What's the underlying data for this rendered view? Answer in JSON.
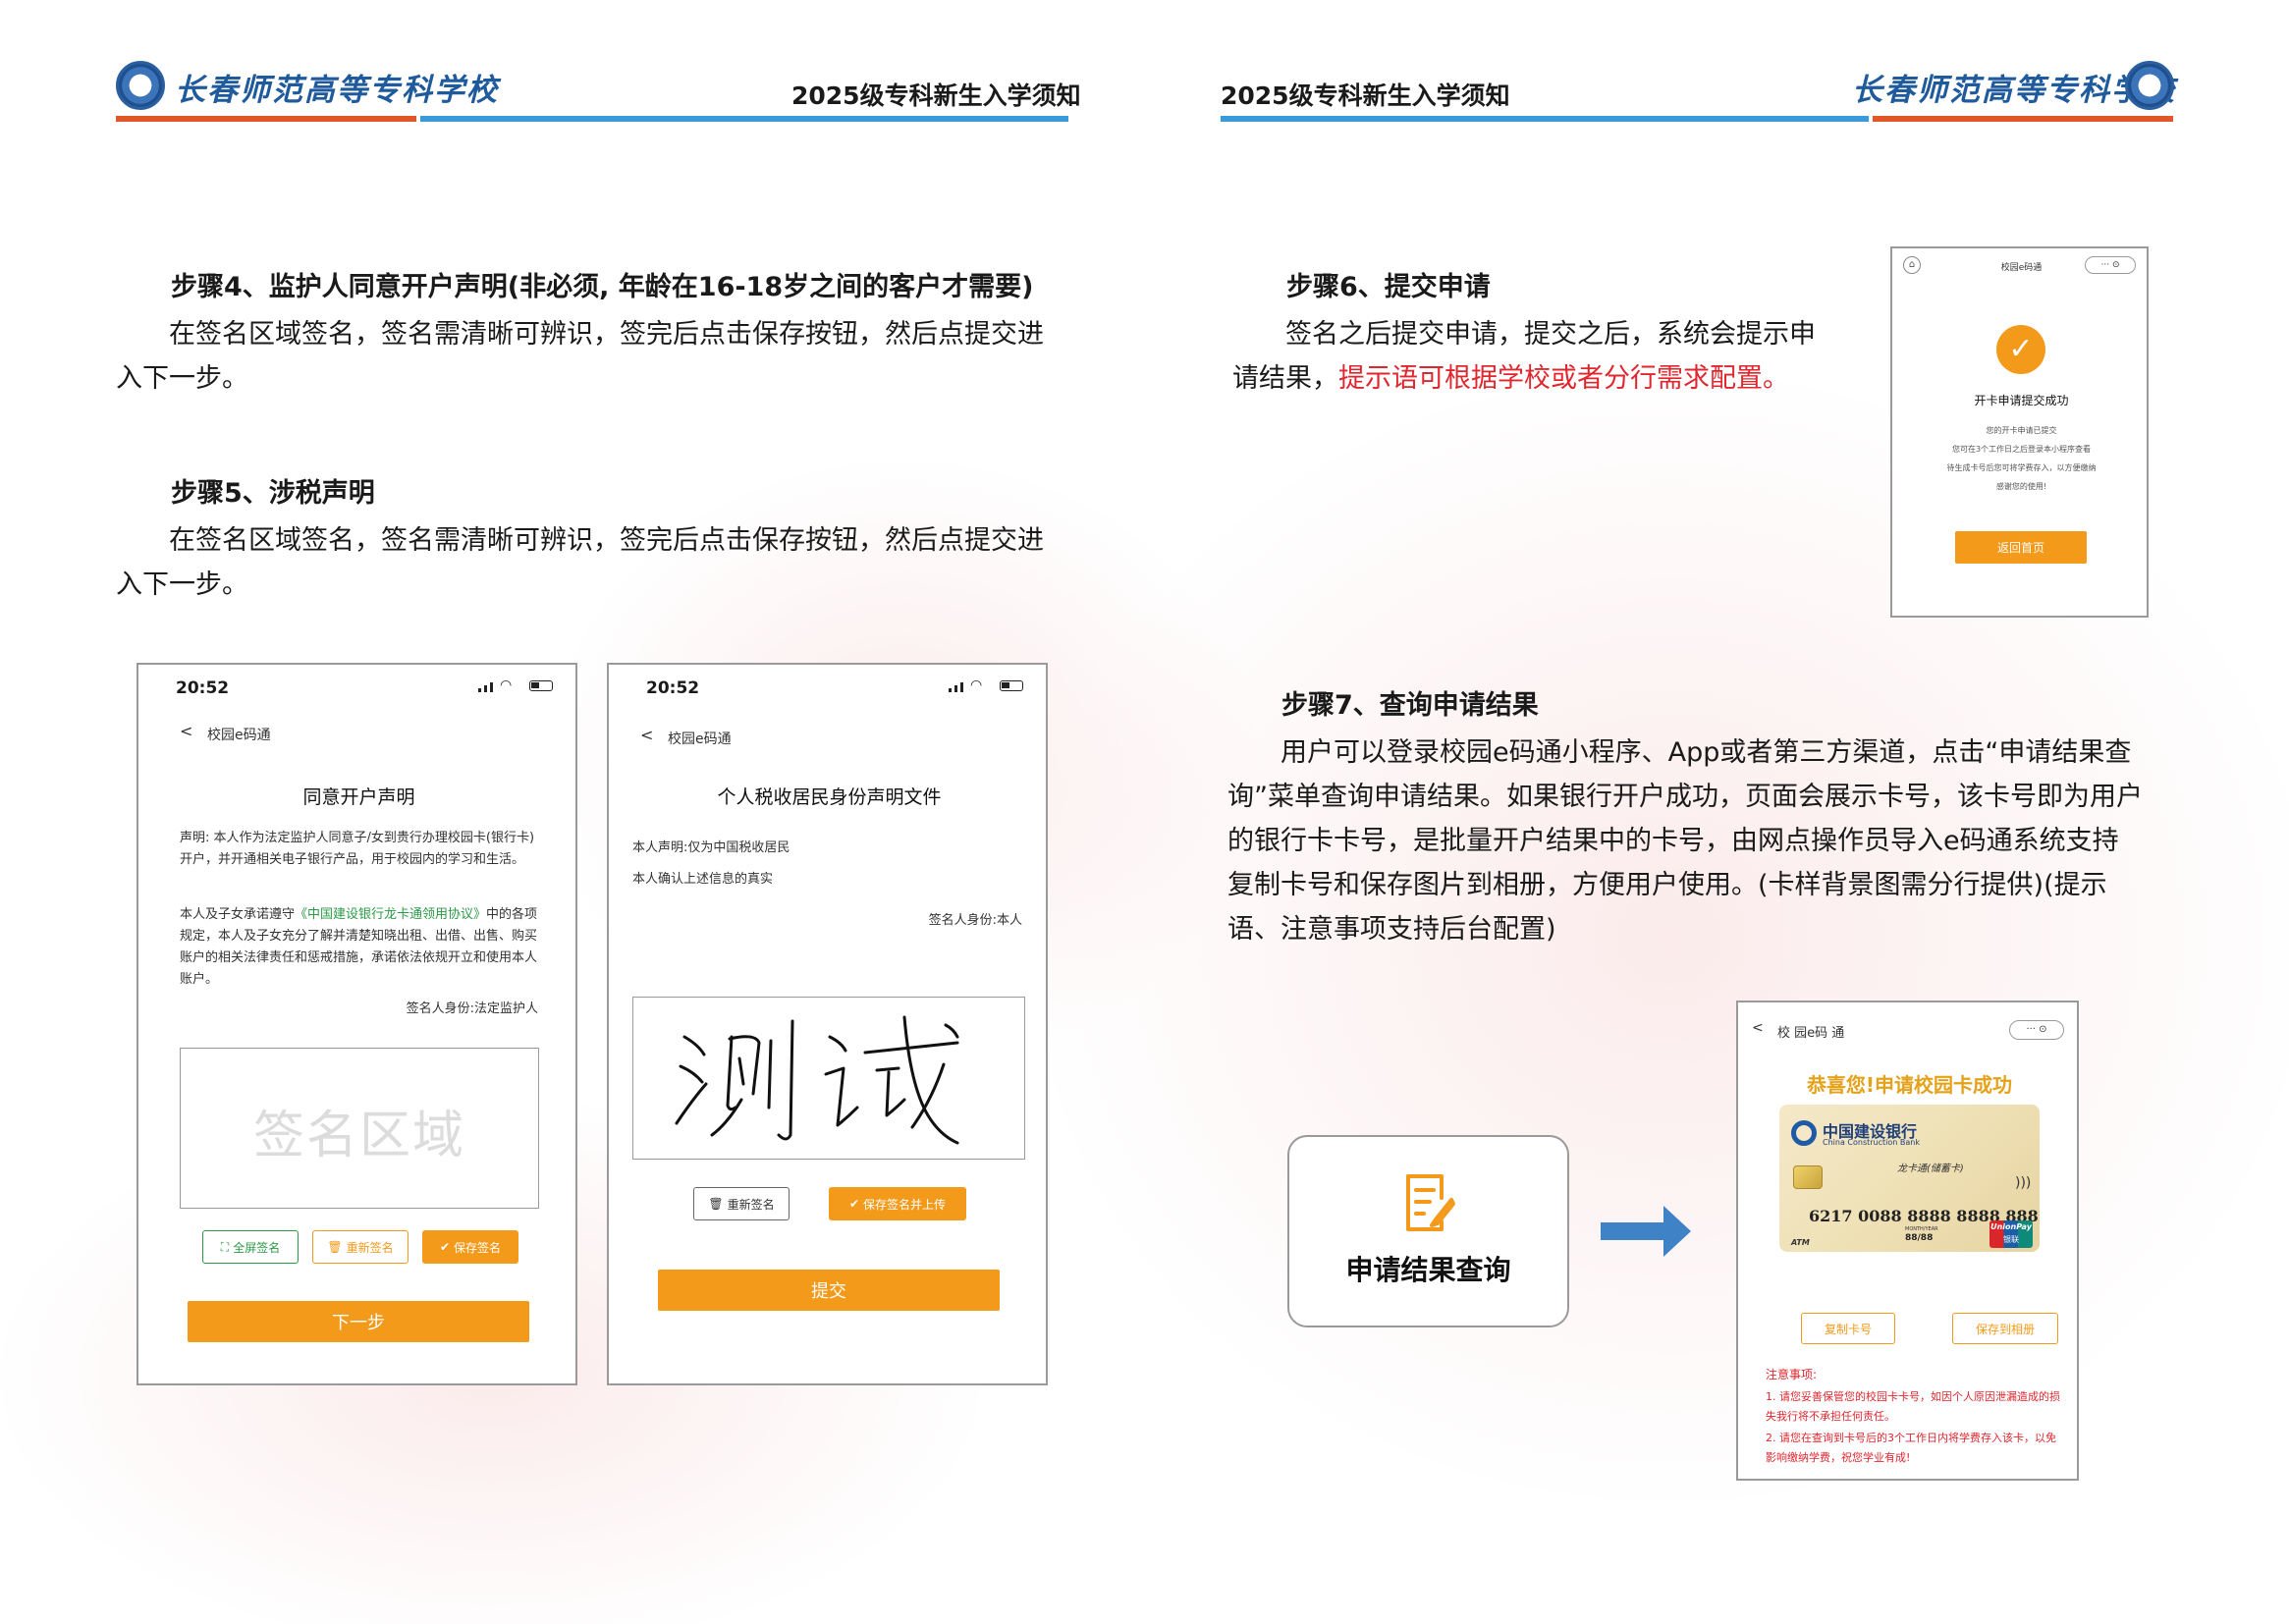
{
  "header": {
    "school_name": "长春师范高等专科学校",
    "doc_title": "2025级专科新生入学须知"
  },
  "left_page": {
    "step4": {
      "heading": "步骤4、监护人同意开户声明(非必须, 年龄在16-18岁之间的客户才需要)",
      "line1": "在签名区域签名，签名需清晰可辨识，签完后点击保存按钮，然后点提交进",
      "line2": "入下一步。"
    },
    "step5": {
      "heading": "步骤5、涉税声明",
      "line1": "在签名区域签名，签名需清晰可辨识，签完后点击保存按钮，然后点提交进",
      "line2": "入下一步。"
    },
    "phone1": {
      "time": "20:52",
      "back": "<",
      "nav_title": "校园e码通",
      "title": "同意开户声明",
      "p1": "声明: 本人作为法定监护人同意子/女到贵行办理校园卡(银行卡)开户，并开通相关电子银行产品，用于校园内的学习和生活。",
      "p2_a": "本人及子女承诺遵守",
      "p2_link": "《中国建设银行龙卡通领用协议》",
      "p2_b": "中的各项规定，本人及子女充分了解并清楚知晓出租、出借、出售、购买账户的相关法律责任和惩戒措施，承诺依法依规开立和使用本人账户。",
      "signer": "签名人身份:法定监护人",
      "sign_placeholder": "签名区域",
      "btn_fullscreen": "全屏签名",
      "btn_resign": "重新签名",
      "btn_save": "保存签名",
      "btn_next": "下一步"
    },
    "phone2": {
      "time": "20:52",
      "back": "<",
      "nav_title": "校园e码通",
      "title": "个人税收居民身份声明文件",
      "l1": "本人声明:仅为中国税收居民",
      "l2": "本人确认上述信息的真实",
      "signer": "签名人身份:本人",
      "btn_resign": "重新签名",
      "btn_save_upload": "保存签名并上传",
      "btn_submit": "提交"
    }
  },
  "right_page": {
    "step6": {
      "heading": "步骤6、提交申请",
      "line1": "签名之后提交申请，提交之后，系统会提示申",
      "line2_a": "请结果，",
      "line2_red": "提示语可根据学校或者分行需求配置。"
    },
    "phone3": {
      "nav_title": "校园e码通",
      "success_title": "开卡申请提交成功",
      "l1": "您的开卡申请已提交",
      "l2": "您可在3个工作日之后登录本小程序查看",
      "l3": "待生成卡号后您可将学费存入，以方便缴纳",
      "l4": "感谢您的使用!",
      "btn_home": "返回首页"
    },
    "step7": {
      "heading": "步骤7、查询申请结果",
      "line1": "用户可以登录校园e码通小程序、App或者第三方渠道，点击“申请结果查",
      "line2": "询”菜单查询申请结果。如果银行开户成功，页面会展示卡号，该卡号即为用户",
      "line3": "的银行卡卡号，是批量开户结果中的卡号，由网点操作员导入e码通系统支持",
      "line4": "复制卡号和保存图片到相册，方便用户使用。(卡样背景图需分行提供)(提示",
      "line5": "语、注意事项支持后台配置)"
    },
    "query_box": {
      "label": "申请结果查询"
    },
    "phone4": {
      "back": "<",
      "nav_title": "校 园e码 通",
      "congrats": "恭喜您!申请校园卡成功",
      "bank_cn": "中国建设银行",
      "bank_en": "China Construction Bank",
      "card_type": "龙卡通(储蓄卡)",
      "card_number": "6217 0088 8888 8888 888",
      "valid_label": "MONTH/YEAR",
      "valid": "88/88",
      "atm": "ATM",
      "unionpay": "UnionPay",
      "unionpay_cn": "银联",
      "btn_copy": "复制卡号",
      "btn_save": "保存到相册",
      "notes_title": "注意事项:",
      "note1": "1. 请您妥善保管您的校园卡卡号，如因个人原因泄漏造成的损失我行将不承担任何责任。",
      "note2": "2. 请您在查询到卡号后的3个工作日内将学费存入该卡，以免影响缴纳学费，祝您学业有成!"
    }
  },
  "colors": {
    "orange_rule": "#e2572a",
    "blue_rule": "#3a9ad9",
    "button_orange": "#f39a1a",
    "red_text": "#e0262e",
    "link_green": "#2c9a47"
  }
}
